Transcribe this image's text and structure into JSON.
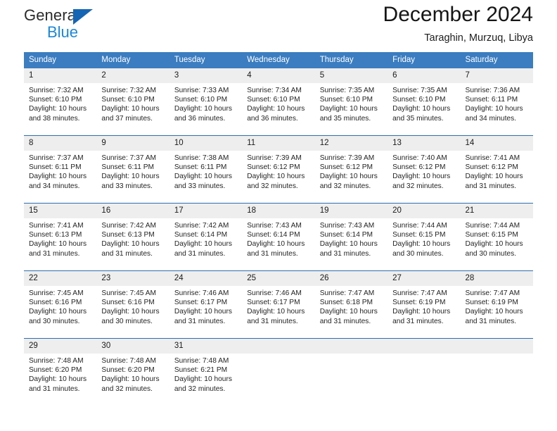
{
  "brand": {
    "name_part1": "General",
    "name_part2": "Blue",
    "triangle_color": "#1565b5",
    "blue_color": "#1b87d8"
  },
  "header": {
    "title": "December 2024",
    "location": "Taraghin, Murzuq, Libya"
  },
  "theme": {
    "header_row_bg": "#3b7dc0",
    "daynum_bg": "#eeeeee",
    "separator_line": "#2f6fb0",
    "text": "#242424"
  },
  "weekdays": [
    "Sunday",
    "Monday",
    "Tuesday",
    "Wednesday",
    "Thursday",
    "Friday",
    "Saturday"
  ],
  "labels": {
    "sunrise_prefix": "Sunrise:",
    "sunset_prefix": "Sunset:",
    "daylight_prefix": "Daylight:"
  },
  "weeks": [
    {
      "days": [
        {
          "num": "1",
          "sunrise": "Sunrise: 7:32 AM",
          "sunset": "Sunset: 6:10 PM",
          "daylight_l1": "Daylight: 10 hours",
          "daylight_l2": "and 38 minutes."
        },
        {
          "num": "2",
          "sunrise": "Sunrise: 7:32 AM",
          "sunset": "Sunset: 6:10 PM",
          "daylight_l1": "Daylight: 10 hours",
          "daylight_l2": "and 37 minutes."
        },
        {
          "num": "3",
          "sunrise": "Sunrise: 7:33 AM",
          "sunset": "Sunset: 6:10 PM",
          "daylight_l1": "Daylight: 10 hours",
          "daylight_l2": "and 36 minutes."
        },
        {
          "num": "4",
          "sunrise": "Sunrise: 7:34 AM",
          "sunset": "Sunset: 6:10 PM",
          "daylight_l1": "Daylight: 10 hours",
          "daylight_l2": "and 36 minutes."
        },
        {
          "num": "5",
          "sunrise": "Sunrise: 7:35 AM",
          "sunset": "Sunset: 6:10 PM",
          "daylight_l1": "Daylight: 10 hours",
          "daylight_l2": "and 35 minutes."
        },
        {
          "num": "6",
          "sunrise": "Sunrise: 7:35 AM",
          "sunset": "Sunset: 6:10 PM",
          "daylight_l1": "Daylight: 10 hours",
          "daylight_l2": "and 35 minutes."
        },
        {
          "num": "7",
          "sunrise": "Sunrise: 7:36 AM",
          "sunset": "Sunset: 6:11 PM",
          "daylight_l1": "Daylight: 10 hours",
          "daylight_l2": "and 34 minutes."
        }
      ]
    },
    {
      "days": [
        {
          "num": "8",
          "sunrise": "Sunrise: 7:37 AM",
          "sunset": "Sunset: 6:11 PM",
          "daylight_l1": "Daylight: 10 hours",
          "daylight_l2": "and 34 minutes."
        },
        {
          "num": "9",
          "sunrise": "Sunrise: 7:37 AM",
          "sunset": "Sunset: 6:11 PM",
          "daylight_l1": "Daylight: 10 hours",
          "daylight_l2": "and 33 minutes."
        },
        {
          "num": "10",
          "sunrise": "Sunrise: 7:38 AM",
          "sunset": "Sunset: 6:11 PM",
          "daylight_l1": "Daylight: 10 hours",
          "daylight_l2": "and 33 minutes."
        },
        {
          "num": "11",
          "sunrise": "Sunrise: 7:39 AM",
          "sunset": "Sunset: 6:12 PM",
          "daylight_l1": "Daylight: 10 hours",
          "daylight_l2": "and 32 minutes."
        },
        {
          "num": "12",
          "sunrise": "Sunrise: 7:39 AM",
          "sunset": "Sunset: 6:12 PM",
          "daylight_l1": "Daylight: 10 hours",
          "daylight_l2": "and 32 minutes."
        },
        {
          "num": "13",
          "sunrise": "Sunrise: 7:40 AM",
          "sunset": "Sunset: 6:12 PM",
          "daylight_l1": "Daylight: 10 hours",
          "daylight_l2": "and 32 minutes."
        },
        {
          "num": "14",
          "sunrise": "Sunrise: 7:41 AM",
          "sunset": "Sunset: 6:12 PM",
          "daylight_l1": "Daylight: 10 hours",
          "daylight_l2": "and 31 minutes."
        }
      ]
    },
    {
      "days": [
        {
          "num": "15",
          "sunrise": "Sunrise: 7:41 AM",
          "sunset": "Sunset: 6:13 PM",
          "daylight_l1": "Daylight: 10 hours",
          "daylight_l2": "and 31 minutes."
        },
        {
          "num": "16",
          "sunrise": "Sunrise: 7:42 AM",
          "sunset": "Sunset: 6:13 PM",
          "daylight_l1": "Daylight: 10 hours",
          "daylight_l2": "and 31 minutes."
        },
        {
          "num": "17",
          "sunrise": "Sunrise: 7:42 AM",
          "sunset": "Sunset: 6:14 PM",
          "daylight_l1": "Daylight: 10 hours",
          "daylight_l2": "and 31 minutes."
        },
        {
          "num": "18",
          "sunrise": "Sunrise: 7:43 AM",
          "sunset": "Sunset: 6:14 PM",
          "daylight_l1": "Daylight: 10 hours",
          "daylight_l2": "and 31 minutes."
        },
        {
          "num": "19",
          "sunrise": "Sunrise: 7:43 AM",
          "sunset": "Sunset: 6:14 PM",
          "daylight_l1": "Daylight: 10 hours",
          "daylight_l2": "and 31 minutes."
        },
        {
          "num": "20",
          "sunrise": "Sunrise: 7:44 AM",
          "sunset": "Sunset: 6:15 PM",
          "daylight_l1": "Daylight: 10 hours",
          "daylight_l2": "and 30 minutes."
        },
        {
          "num": "21",
          "sunrise": "Sunrise: 7:44 AM",
          "sunset": "Sunset: 6:15 PM",
          "daylight_l1": "Daylight: 10 hours",
          "daylight_l2": "and 30 minutes."
        }
      ]
    },
    {
      "days": [
        {
          "num": "22",
          "sunrise": "Sunrise: 7:45 AM",
          "sunset": "Sunset: 6:16 PM",
          "daylight_l1": "Daylight: 10 hours",
          "daylight_l2": "and 30 minutes."
        },
        {
          "num": "23",
          "sunrise": "Sunrise: 7:45 AM",
          "sunset": "Sunset: 6:16 PM",
          "daylight_l1": "Daylight: 10 hours",
          "daylight_l2": "and 30 minutes."
        },
        {
          "num": "24",
          "sunrise": "Sunrise: 7:46 AM",
          "sunset": "Sunset: 6:17 PM",
          "daylight_l1": "Daylight: 10 hours",
          "daylight_l2": "and 31 minutes."
        },
        {
          "num": "25",
          "sunrise": "Sunrise: 7:46 AM",
          "sunset": "Sunset: 6:17 PM",
          "daylight_l1": "Daylight: 10 hours",
          "daylight_l2": "and 31 minutes."
        },
        {
          "num": "26",
          "sunrise": "Sunrise: 7:47 AM",
          "sunset": "Sunset: 6:18 PM",
          "daylight_l1": "Daylight: 10 hours",
          "daylight_l2": "and 31 minutes."
        },
        {
          "num": "27",
          "sunrise": "Sunrise: 7:47 AM",
          "sunset": "Sunset: 6:19 PM",
          "daylight_l1": "Daylight: 10 hours",
          "daylight_l2": "and 31 minutes."
        },
        {
          "num": "28",
          "sunrise": "Sunrise: 7:47 AM",
          "sunset": "Sunset: 6:19 PM",
          "daylight_l1": "Daylight: 10 hours",
          "daylight_l2": "and 31 minutes."
        }
      ]
    },
    {
      "days": [
        {
          "num": "29",
          "sunrise": "Sunrise: 7:48 AM",
          "sunset": "Sunset: 6:20 PM",
          "daylight_l1": "Daylight: 10 hours",
          "daylight_l2": "and 31 minutes."
        },
        {
          "num": "30",
          "sunrise": "Sunrise: 7:48 AM",
          "sunset": "Sunset: 6:20 PM",
          "daylight_l1": "Daylight: 10 hours",
          "daylight_l2": "and 32 minutes."
        },
        {
          "num": "31",
          "sunrise": "Sunrise: 7:48 AM",
          "sunset": "Sunset: 6:21 PM",
          "daylight_l1": "Daylight: 10 hours",
          "daylight_l2": "and 32 minutes."
        },
        {
          "num": "",
          "sunrise": "",
          "sunset": "",
          "daylight_l1": "",
          "daylight_l2": ""
        },
        {
          "num": "",
          "sunrise": "",
          "sunset": "",
          "daylight_l1": "",
          "daylight_l2": ""
        },
        {
          "num": "",
          "sunrise": "",
          "sunset": "",
          "daylight_l1": "",
          "daylight_l2": ""
        },
        {
          "num": "",
          "sunrise": "",
          "sunset": "",
          "daylight_l1": "",
          "daylight_l2": ""
        }
      ]
    }
  ]
}
